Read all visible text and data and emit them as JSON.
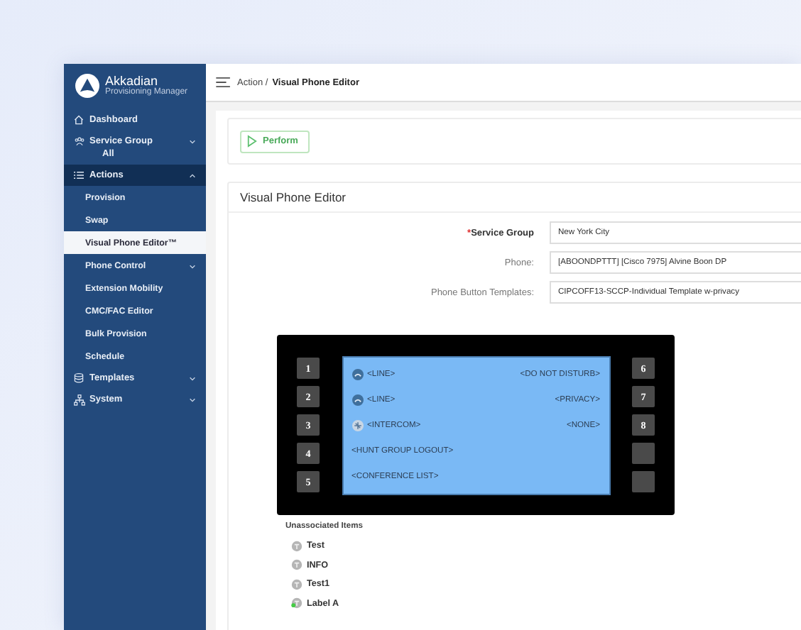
{
  "brand": {
    "name": "Akkadian",
    "subtitle": "Provisioning Manager"
  },
  "sidebar": {
    "items": [
      {
        "kind": "home",
        "label": "Dashboard"
      },
      {
        "kind": "group",
        "label": "Service Group",
        "sublabel": "All",
        "expanded": false
      },
      {
        "kind": "list",
        "label": "Actions",
        "expanded": true,
        "selected": true,
        "children": [
          {
            "label": "Provision",
            "selected": false
          },
          {
            "label": "Swap",
            "selected": false
          },
          {
            "label": "Visual Phone Editor™",
            "selected": true
          },
          {
            "label": "Phone Control",
            "selected": false,
            "expanded": false
          },
          {
            "label": "Extension Mobility",
            "selected": false
          },
          {
            "label": "CMC/FAC Editor",
            "selected": false
          },
          {
            "label": "Bulk Provision",
            "selected": false
          },
          {
            "label": "Schedule",
            "selected": false
          }
        ]
      },
      {
        "kind": "database",
        "label": "Templates",
        "expanded": false
      },
      {
        "kind": "network",
        "label": "System",
        "expanded": false
      }
    ]
  },
  "breadcrumb": {
    "parent": "Action /",
    "current": "Visual Phone Editor"
  },
  "perform_button": {
    "label": "Perform"
  },
  "editor": {
    "title": "Visual Phone Editor",
    "required_mark": "*",
    "fields": [
      {
        "label": "Service Group",
        "required": true,
        "value": "New York City"
      },
      {
        "label": "Phone:",
        "required": false,
        "value": "[ABOONDPTTT] [Cisco 7975] Alvine Boon DP"
      },
      {
        "label": "Phone Button Templates:",
        "required": false,
        "value": "CIPCOFF13-SCCP-Individual Template w-privacy"
      }
    ],
    "phone": {
      "left_buttons": [
        {
          "kind": "number",
          "label": "1"
        },
        {
          "kind": "number",
          "label": "2"
        },
        {
          "kind": "number",
          "label": "3"
        },
        {
          "kind": "number",
          "label": "4"
        },
        {
          "kind": "number",
          "label": "5"
        }
      ],
      "right_buttons": [
        {
          "kind": "number",
          "label": "6"
        },
        {
          "kind": "number",
          "label": "7"
        },
        {
          "kind": "number",
          "label": "8"
        },
        {
          "kind": "blank"
        },
        {
          "kind": "blank"
        }
      ],
      "left_lines": [
        {
          "kind": "line",
          "label": "<LINE>"
        },
        {
          "kind": "line",
          "label": "<LINE>"
        },
        {
          "kind": "intercom",
          "label": "<INTERCOM>"
        },
        {
          "kind": "plain",
          "label": "<HUNT GROUP LOGOUT>"
        },
        {
          "kind": "plain",
          "label": "<CONFERENCE LIST>"
        }
      ],
      "right_lines": [
        {
          "label": "<DO NOT DISTURB>"
        },
        {
          "label": "<PRIVACY>"
        },
        {
          "label": "<NONE>"
        }
      ]
    },
    "unassociated": {
      "title": "Unassociated Items",
      "items": [
        {
          "label": "Test",
          "active": false
        },
        {
          "label": "INFO",
          "active": false
        },
        {
          "label": "Test1",
          "active": false
        },
        {
          "label": "Label A",
          "active": true
        }
      ]
    }
  }
}
